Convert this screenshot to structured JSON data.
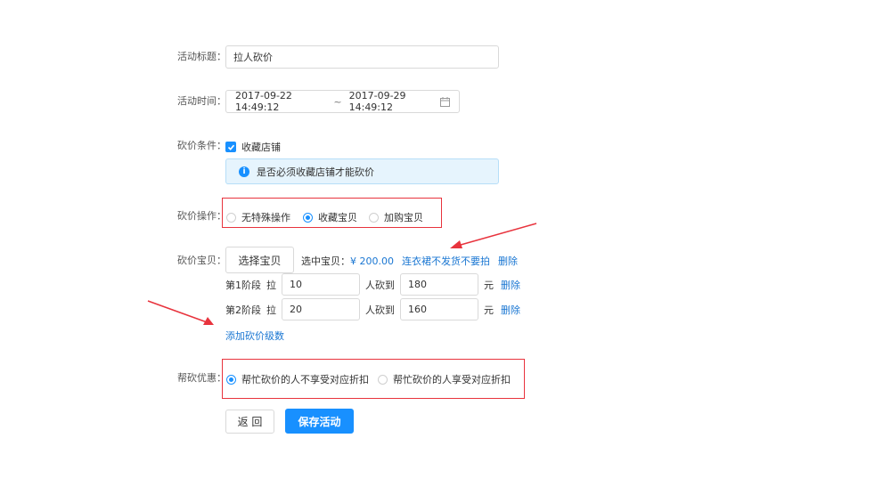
{
  "form": {
    "title_label": "活动标题：",
    "title_value": "拉人砍价",
    "time_label": "活动时间：",
    "time_start": "2017-09-22 14:49:12",
    "time_sep": "~",
    "time_end": "2017-09-29 14:49:12",
    "condition_label": "砍价条件：",
    "condition_checkbox": "收藏店铺",
    "condition_info": "是否必须收藏店铺才能砍价",
    "operation_label": "砍价操作：",
    "operation_options": [
      "无特殊操作",
      "收藏宝贝",
      "加购宝贝"
    ],
    "item_label": "砍价宝贝：",
    "select_item_button": "选择宝贝",
    "selected_prefix": "选中宝贝：",
    "selected_price": "¥ 200.00",
    "selected_item_name": "连衣裙不发货不要拍",
    "delete_label": "删除",
    "stages": [
      {
        "stage": "第1阶段",
        "pull": "拉",
        "people": "10",
        "middle": "人砍到",
        "price": "180",
        "unit": "元",
        "delete": "删除"
      },
      {
        "stage": "第2阶段",
        "pull": "拉",
        "people": "20",
        "middle": "人砍到",
        "price": "160",
        "unit": "元",
        "delete": "删除"
      }
    ],
    "add_stage_link": "添加砍价级数",
    "discount_label": "帮砍优惠：",
    "discount_options": [
      "帮忙砍价的人不享受对应折扣",
      "帮忙砍价的人享受对应折扣"
    ],
    "back_button": "返 回",
    "save_button": "保存活动"
  },
  "colors": {
    "accent": "#1890ff",
    "annotation_red": "#e8333d",
    "link": "#1976d2"
  },
  "icons": {
    "calendar": "calendar-icon",
    "checkbox": "check-icon",
    "info": "info-icon"
  }
}
